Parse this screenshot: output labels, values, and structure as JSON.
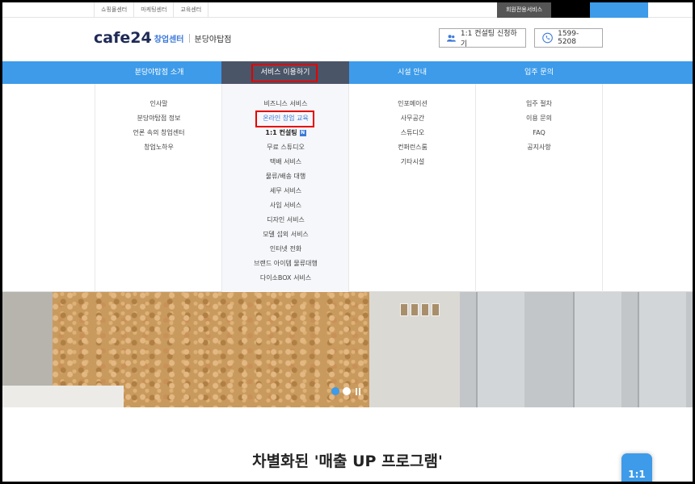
{
  "topbar": {
    "links": [
      "쇼핑몰센터",
      "마케팅센터",
      "교육센터"
    ],
    "member_service": "회원전용서비스"
  },
  "header": {
    "logo_word": "cafe24",
    "logo_sub": "창업센터",
    "branch": "분당야탑점",
    "consult_button": "1:1 컨설팅 신청하기",
    "phone": "1599-5208"
  },
  "nav": {
    "items": [
      {
        "label": "분당야탑점 소개"
      },
      {
        "label": "서비스 이용하기"
      },
      {
        "label": "시설 안내"
      },
      {
        "label": "입주 문의"
      }
    ]
  },
  "dropdown": {
    "col1": [
      "인사말",
      "분당야탑점 정보",
      "언론 속의 창업센터",
      "창업노하우"
    ],
    "col2": [
      "비즈니스 서비스",
      "온라인 창업 교육",
      "1:1 컨설팅",
      "무료 스튜디오",
      "택배 서비스",
      "물류/배송 대행",
      "세무 서비스",
      "사입 서비스",
      "디자인 서비스",
      "모델 섭외 서비스",
      "인터넷 전화",
      "브랜드 아이템 물류대행",
      "다이소BOX 서비스"
    ],
    "col2_new_badge": "N",
    "col3": [
      "인포메이션",
      "사무공간",
      "스튜디오",
      "컨퍼런스룸",
      "기타시설"
    ],
    "col4": [
      "입주 절차",
      "이용 문의",
      "FAQ",
      "공지사항"
    ]
  },
  "section": {
    "title": "차별화된 '매출 UP 프로그램'",
    "chat_badge": "1:1"
  },
  "colors": {
    "accent": "#3d9be9",
    "active_nav": "#4a5568",
    "highlight": "#e60000"
  }
}
